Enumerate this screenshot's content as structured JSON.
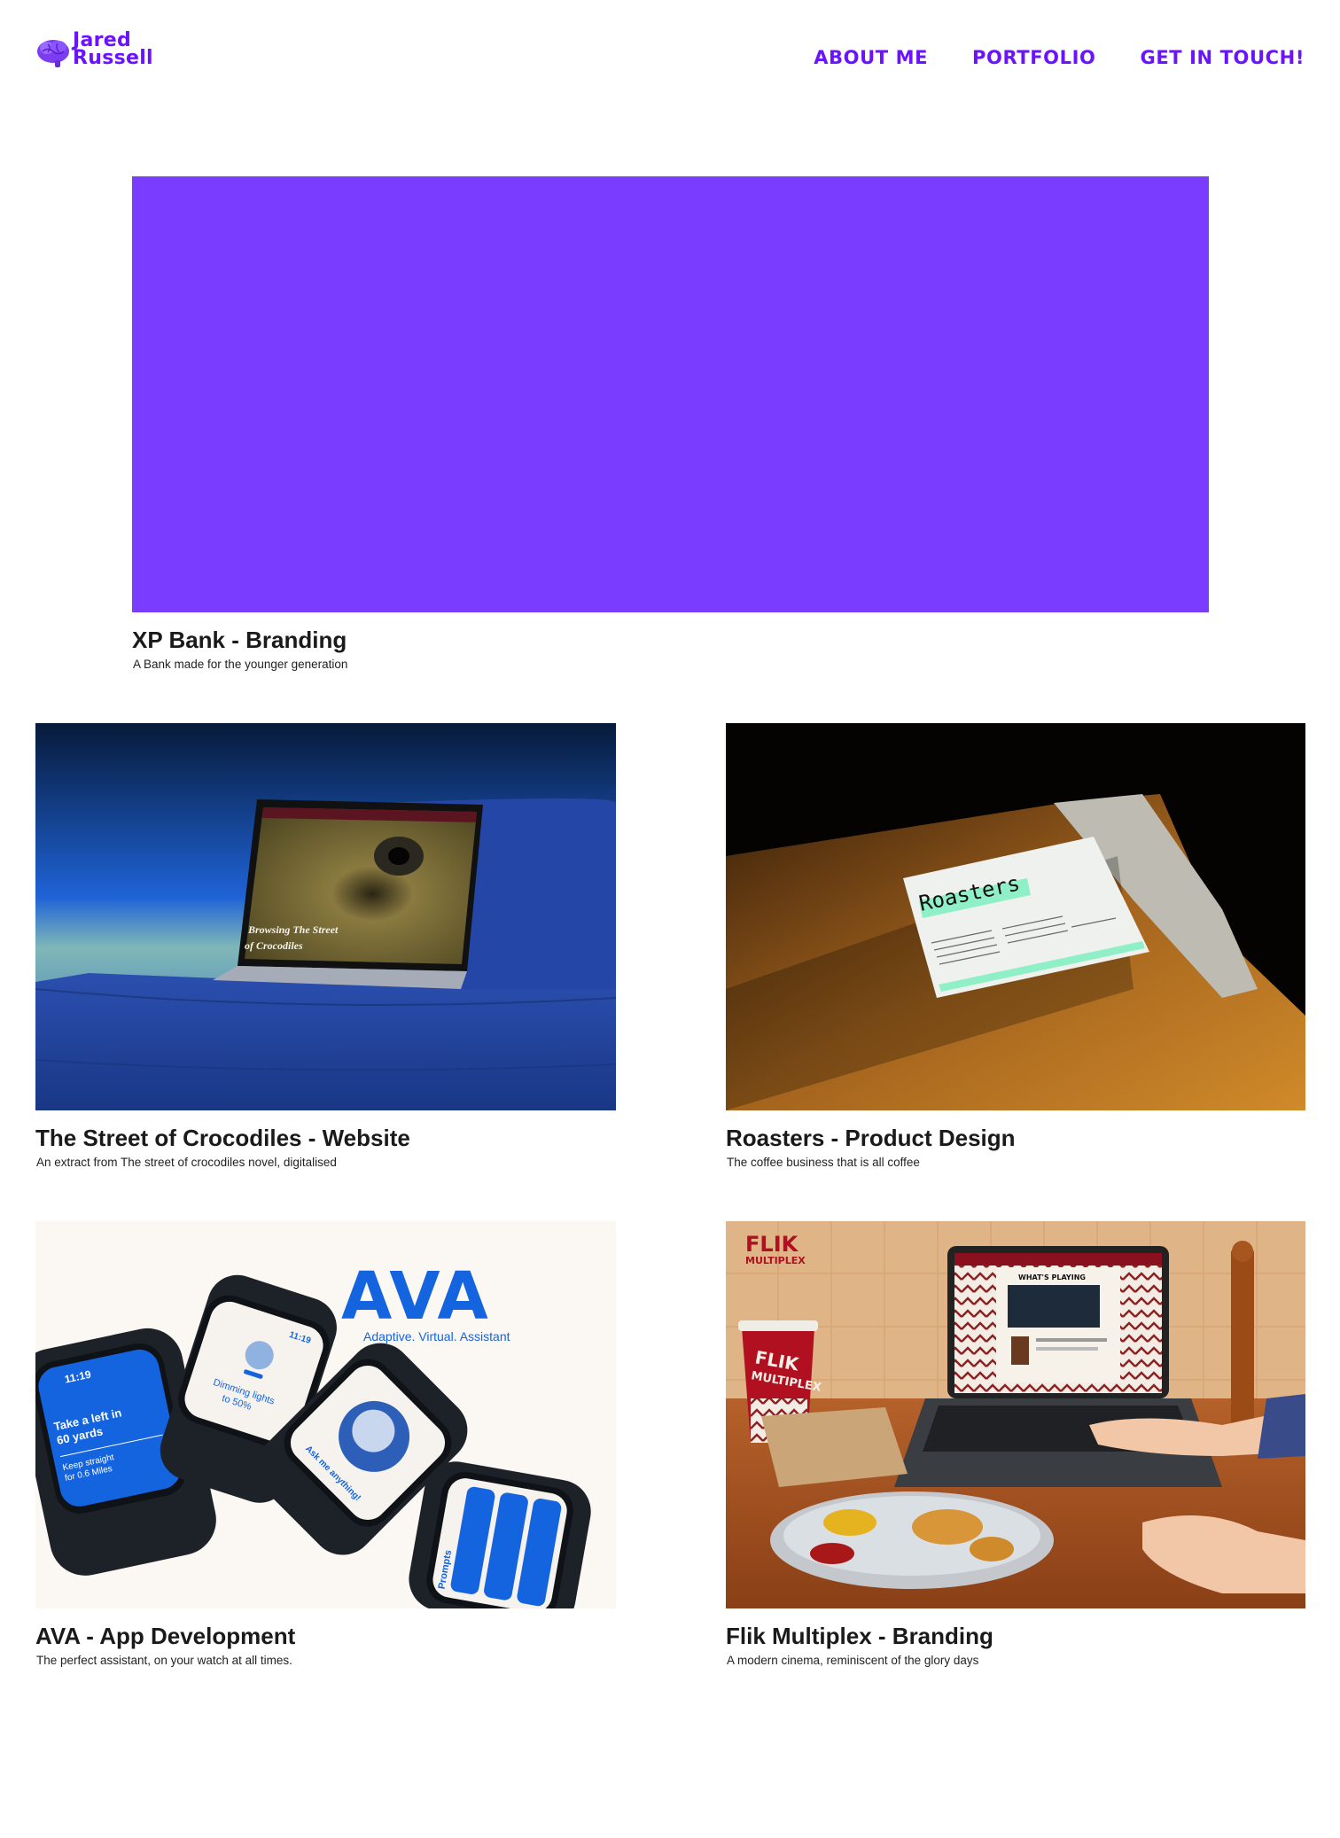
{
  "header": {
    "logo": {
      "line1": "Jared",
      "line2": "Russell",
      "icon": "brain-icon"
    },
    "nav": [
      {
        "label": "ABOUT ME"
      },
      {
        "label": "PORTFOLIO"
      },
      {
        "label": "GET IN TOUCH!"
      }
    ]
  },
  "colors": {
    "brand": "#6b12ff",
    "xp_bank": "#7a3cff"
  },
  "projects": {
    "xp": {
      "title": "XP Bank - Branding",
      "subtitle": "A Bank made for the younger generation"
    },
    "croc": {
      "title": "The Street of Crocodiles - Website",
      "subtitle": "An extract from The street of crocodiles novel, digitalised",
      "screen_line1": "Browsing The Street",
      "screen_line2": "of Crocodiles"
    },
    "roast": {
      "title": "Roasters - Product Design",
      "subtitle": "The coffee business that is all coffee",
      "card_name": "Roasters"
    },
    "ava": {
      "title": "AVA - App Development",
      "subtitle": "The perfect assistant, on your watch at all times.",
      "logo": "AVA",
      "tagline": "Adaptive. Virtual. Assistant",
      "watch_time": "11:19",
      "watch1_line1": "Take a left in",
      "watch1_line2": "60 yards",
      "watch1_line3": "Keep straight",
      "watch1_line4": "for 0.6 Miles",
      "watch2_line1": "Dimming lights",
      "watch2_line2": "to 50%",
      "watch3_text": "Ask me anything!",
      "watch4_text": "Prompts"
    },
    "flik": {
      "title": "Flik Multiplex - Branding",
      "subtitle": "A modern cinema, reminiscent of the glory days",
      "brand_line1": "FLIK",
      "brand_line2": "MULTIPLEX",
      "screen_heading": "WHAT'S PLAYING",
      "cup_line1": "FLIK",
      "cup_line2": "MULTIPLEX"
    }
  }
}
